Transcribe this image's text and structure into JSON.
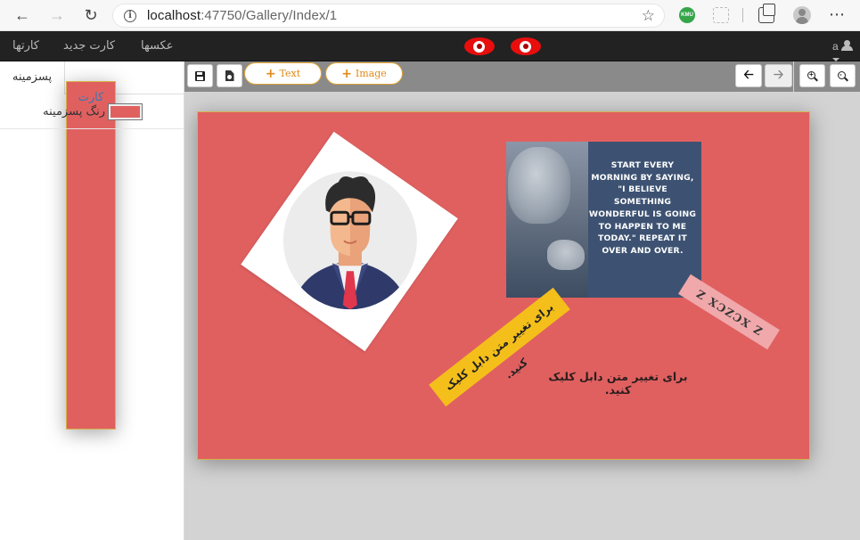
{
  "browser": {
    "url_host": "localhost",
    "url_rest": ":47750/Gallery/Index/1",
    "extension_badge": "KMU",
    "more": "⋯"
  },
  "navbar": {
    "links": [
      "کارتها",
      "کارت جدید",
      "عکسها"
    ],
    "user": "a",
    "eye_color": "#e80e0e"
  },
  "left_panel": {
    "tabs": {
      "background": "پسزمینه",
      "card": "کارت"
    },
    "background_label": "رنگ پسزمینه",
    "background_color": "#e06060"
  },
  "toolbar": {
    "save_icon": "floppy-disk-icon",
    "export_icon": "export-image-icon",
    "add_text_label": "Text",
    "add_image_label": "Image",
    "undo_icon": "arrow-left-icon",
    "redo_icon": "arrow-right-icon",
    "zoom_in_icon": "zoom-in-icon",
    "zoom_out_icon": "zoom-out-icon"
  },
  "canvas": {
    "card_color": "#e06060",
    "quote_text": "START EVERY MORNING BY SAYING, \"I BELIEVE SOMETHING WONDERFUL IS GOING TO HAPPEN TO ME TODAY.\" REPEAT IT OVER AND OVER.",
    "pink_text": "Z XCZCX Z",
    "yellow_text": "برای تغییر متن دابل کلیک کنید.",
    "plain_text": "برای تغییر متن دابل کلیک کنید."
  }
}
